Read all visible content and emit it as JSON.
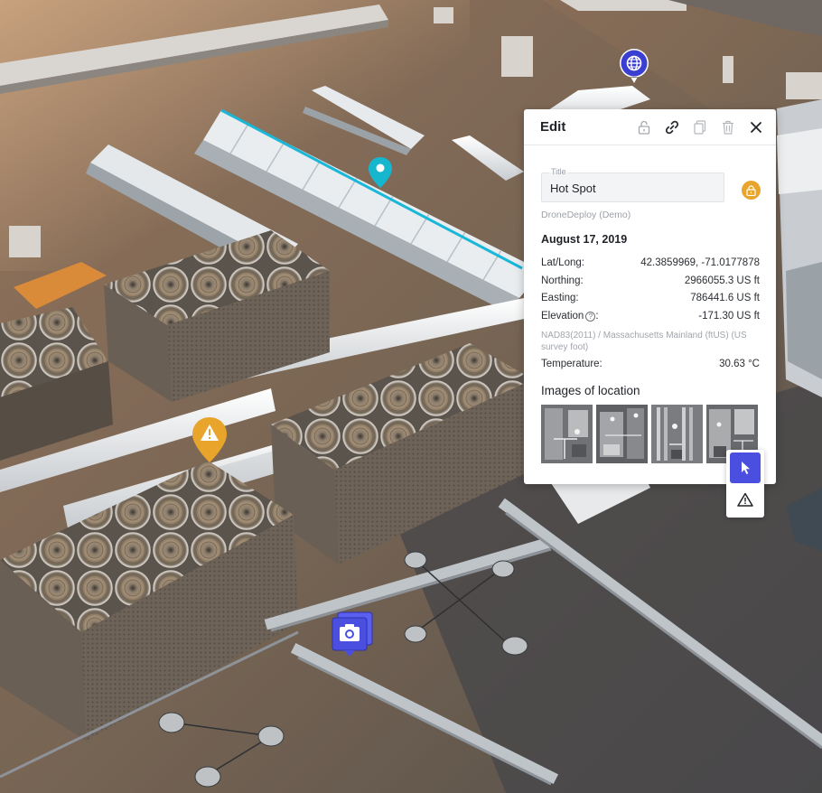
{
  "colors": {
    "accent": "#4a4fe0",
    "marker_globe": "#3b3fd1",
    "marker_pin": "#17b6cf",
    "marker_warning": "#e8a42b",
    "lock_badge": "#e8a42b",
    "measure_line": "#19b7d8"
  },
  "icons": {
    "globe": "globe-icon",
    "pin": "location-pin-icon",
    "warning": "warning-icon",
    "camera": "camera-icon",
    "lock": "lock-icon",
    "link": "link-icon",
    "copy": "copy-icon",
    "trash": "trash-icon",
    "close": "close-icon",
    "cursor": "cursor-icon"
  },
  "panel": {
    "header_title": "Edit",
    "title_field": {
      "label": "Title",
      "value": "Hot Spot"
    },
    "source": "DroneDeploy (Demo)",
    "date": "August 17, 2019",
    "rows": {
      "latlong": {
        "label": "Lat/Long:",
        "value": "42.3859969, -71.0177878"
      },
      "northing": {
        "label": "Northing:",
        "value": "2966055.3 US ft"
      },
      "easting": {
        "label": "Easting:",
        "value": "786441.6 US ft"
      },
      "elevation": {
        "label": "Elevation",
        "help": "?",
        "suffix": ":",
        "value": "-171.30 US ft"
      },
      "temperature": {
        "label": "Temperature:",
        "value": "30.63 °C"
      }
    },
    "crs_note": "NAD83(2011) / Massachusetts Mainland (ftUS) (US survey foot)",
    "images_heading": "Images of location",
    "images_count": 4
  },
  "tools": {
    "active": "select"
  }
}
